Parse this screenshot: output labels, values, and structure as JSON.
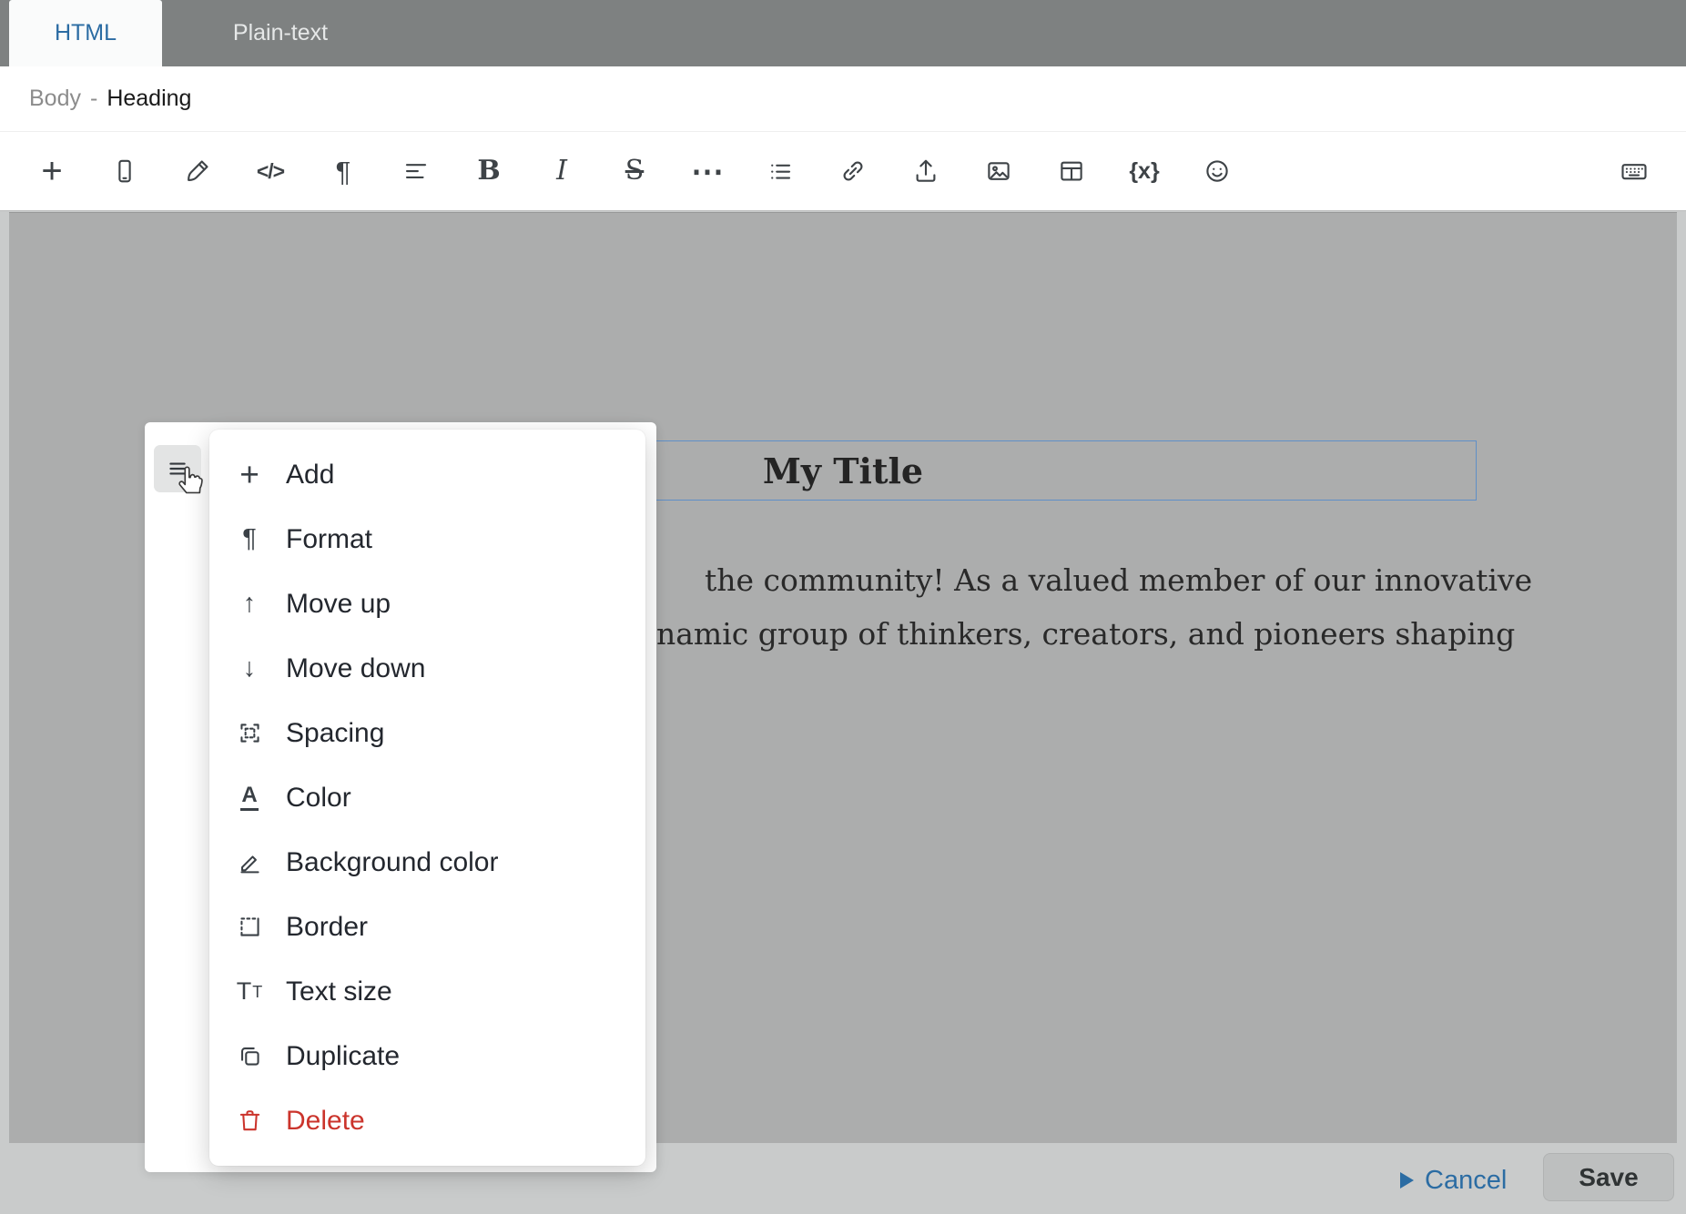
{
  "tabs": {
    "html_label": "HTML",
    "plain_label": "Plain-text"
  },
  "breadcrumb": {
    "section": "Body",
    "separator": "-",
    "item": "Heading"
  },
  "toolbar": {
    "items": [
      {
        "name": "add",
        "glyph": "+"
      },
      {
        "name": "mobile-preview"
      },
      {
        "name": "brush"
      },
      {
        "name": "source-code",
        "glyph": "</>"
      },
      {
        "name": "paragraph-format",
        "glyph": "¶"
      },
      {
        "name": "alignment"
      },
      {
        "name": "bold",
        "glyph": "B"
      },
      {
        "name": "italic",
        "glyph": "I"
      },
      {
        "name": "strikethrough",
        "glyph": "S"
      },
      {
        "name": "more-formats",
        "glyph": "⋯"
      },
      {
        "name": "list"
      },
      {
        "name": "link"
      },
      {
        "name": "upload"
      },
      {
        "name": "image"
      },
      {
        "name": "table"
      },
      {
        "name": "merge-tags",
        "glyph": "{x}"
      },
      {
        "name": "emoji"
      },
      {
        "name": "keyboard-shortcuts"
      }
    ]
  },
  "content": {
    "heading_text": "My Title",
    "paragraph_line1": "the community! As a valued member of our innovative",
    "paragraph_line2": "namic group of thinkers, creators, and pioneers shaping"
  },
  "block_menu": {
    "items": [
      {
        "label": "Add",
        "icon": "add",
        "glyph": "+"
      },
      {
        "label": "Format",
        "icon": "format",
        "glyph": "¶"
      },
      {
        "label": "Move up",
        "icon": "move-up",
        "glyph": "↑"
      },
      {
        "label": "Move down",
        "icon": "move-down",
        "glyph": "↓"
      },
      {
        "label": "Spacing",
        "icon": "spacing"
      },
      {
        "label": "Color",
        "icon": "text-color",
        "glyph": "A"
      },
      {
        "label": "Background color",
        "icon": "background-color"
      },
      {
        "label": "Border",
        "icon": "border"
      },
      {
        "label": "Text size",
        "icon": "text-size",
        "glyph": "T",
        "glyph_small": "T"
      },
      {
        "label": "Duplicate",
        "icon": "duplicate"
      },
      {
        "label": "Delete",
        "icon": "delete",
        "danger": true
      }
    ]
  },
  "footer": {
    "cancel_label": "Cancel",
    "save_label": "Save"
  },
  "colors": {
    "accent_blue": "#2b6ca3",
    "danger_red": "#cb342c",
    "selection_border": "#5f8fc7",
    "header_gray": "#7e8181",
    "canvas_gray": "#acadad"
  }
}
